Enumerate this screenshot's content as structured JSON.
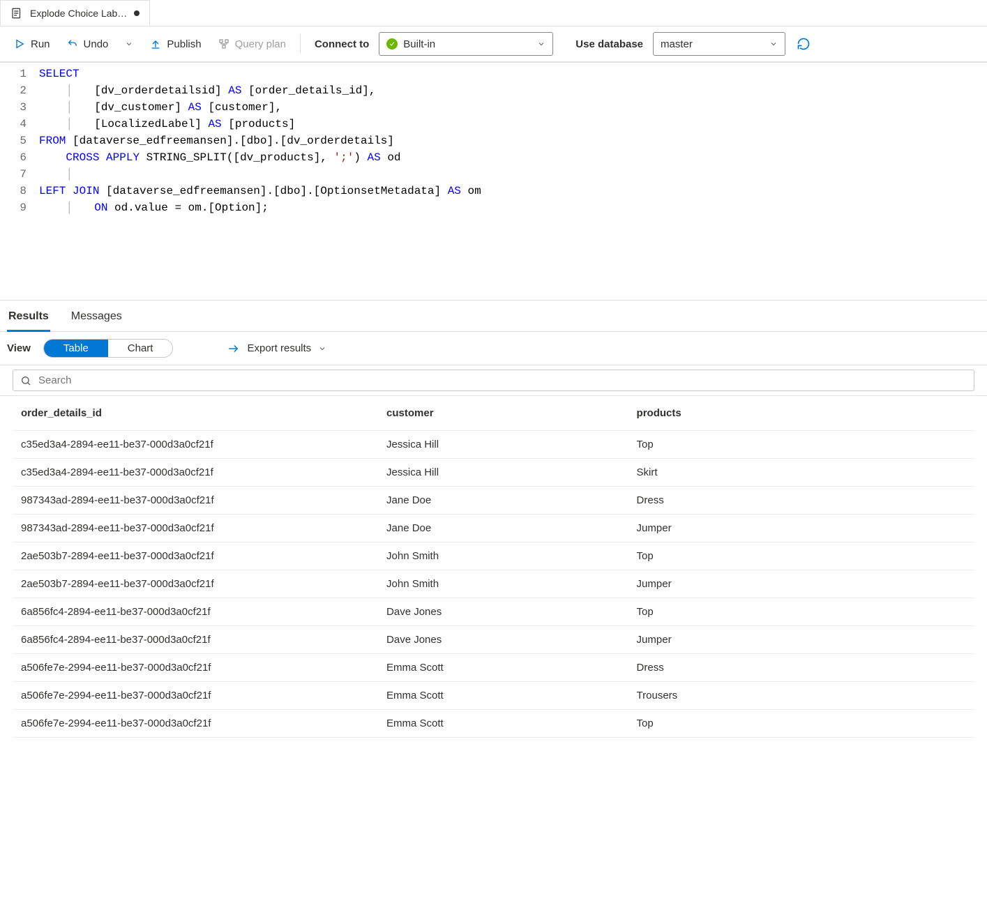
{
  "tab": {
    "title": "Explode Choice Lab…",
    "dirty": true
  },
  "toolbar": {
    "run": "Run",
    "undo": "Undo",
    "publish": "Publish",
    "query_plan": "Query plan",
    "connect_to_label": "Connect to",
    "built_in": "Built-in",
    "use_database_label": "Use database",
    "database": "master"
  },
  "editor": {
    "lines": [
      [
        {
          "t": "SELECT",
          "c": "kw"
        }
      ],
      [
        {
          "t": "    ",
          "c": "indent"
        },
        {
          "t": "│",
          "c": "vbar"
        },
        {
          "t": "   [dv_orderdetailsid] ",
          "c": "id"
        },
        {
          "t": "AS",
          "c": "kw"
        },
        {
          "t": " [order_details_id],",
          "c": "id"
        }
      ],
      [
        {
          "t": "    ",
          "c": "indent"
        },
        {
          "t": "│",
          "c": "vbar"
        },
        {
          "t": "   [dv_customer] ",
          "c": "id"
        },
        {
          "t": "AS",
          "c": "kw"
        },
        {
          "t": " [customer],",
          "c": "id"
        }
      ],
      [
        {
          "t": "    ",
          "c": "indent"
        },
        {
          "t": "│",
          "c": "vbar"
        },
        {
          "t": "   [LocalizedLabel] ",
          "c": "id"
        },
        {
          "t": "AS",
          "c": "kw"
        },
        {
          "t": " [products]",
          "c": "id"
        }
      ],
      [
        {
          "t": "FROM",
          "c": "kw"
        },
        {
          "t": " [dataverse_edfreemansen].[dbo].[dv_orderdetails]",
          "c": "id"
        }
      ],
      [
        {
          "t": "    ",
          "c": "indent"
        },
        {
          "t": "CROSS",
          "c": "kw"
        },
        {
          "t": " ",
          "c": "id"
        },
        {
          "t": "APPLY",
          "c": "kw"
        },
        {
          "t": " STRING_SPLIT([dv_products], ",
          "c": "fn"
        },
        {
          "t": "';'",
          "c": "str"
        },
        {
          "t": ") ",
          "c": "fn"
        },
        {
          "t": "AS",
          "c": "kw"
        },
        {
          "t": " od",
          "c": "id"
        }
      ],
      [
        {
          "t": "    ",
          "c": "indent"
        },
        {
          "t": "│",
          "c": "vbar"
        }
      ],
      [
        {
          "t": "LEFT",
          "c": "kw"
        },
        {
          "t": " ",
          "c": "id"
        },
        {
          "t": "JOIN",
          "c": "kw"
        },
        {
          "t": " [dataverse_edfreemansen].[dbo].[OptionsetMetadata] ",
          "c": "id"
        },
        {
          "t": "AS",
          "c": "kw"
        },
        {
          "t": " om",
          "c": "id"
        }
      ],
      [
        {
          "t": "    ",
          "c": "indent"
        },
        {
          "t": "│",
          "c": "vbar"
        },
        {
          "t": "   ",
          "c": "id"
        },
        {
          "t": "ON",
          "c": "kw"
        },
        {
          "t": " od.value = om.[Option];",
          "c": "id"
        }
      ]
    ]
  },
  "results": {
    "tabs": {
      "results": "Results",
      "messages": "Messages"
    },
    "view_label": "View",
    "pills": {
      "table": "Table",
      "chart": "Chart"
    },
    "export_label": "Export results",
    "search_placeholder": "Search",
    "columns": [
      "order_details_id",
      "customer",
      "products"
    ],
    "rows": [
      [
        "c35ed3a4-2894-ee11-be37-000d3a0cf21f",
        "Jessica Hill",
        "Top"
      ],
      [
        "c35ed3a4-2894-ee11-be37-000d3a0cf21f",
        "Jessica Hill",
        "Skirt"
      ],
      [
        "987343ad-2894-ee11-be37-000d3a0cf21f",
        "Jane Doe",
        "Dress"
      ],
      [
        "987343ad-2894-ee11-be37-000d3a0cf21f",
        "Jane Doe",
        "Jumper"
      ],
      [
        "2ae503b7-2894-ee11-be37-000d3a0cf21f",
        "John Smith",
        "Top"
      ],
      [
        "2ae503b7-2894-ee11-be37-000d3a0cf21f",
        "John Smith",
        "Jumper"
      ],
      [
        "6a856fc4-2894-ee11-be37-000d3a0cf21f",
        "Dave Jones",
        "Top"
      ],
      [
        "6a856fc4-2894-ee11-be37-000d3a0cf21f",
        "Dave Jones",
        "Jumper"
      ],
      [
        "a506fe7e-2994-ee11-be37-000d3a0cf21f",
        "Emma Scott",
        "Dress"
      ],
      [
        "a506fe7e-2994-ee11-be37-000d3a0cf21f",
        "Emma Scott",
        "Trousers"
      ],
      [
        "a506fe7e-2994-ee11-be37-000d3a0cf21f",
        "Emma Scott",
        "Top"
      ]
    ]
  }
}
